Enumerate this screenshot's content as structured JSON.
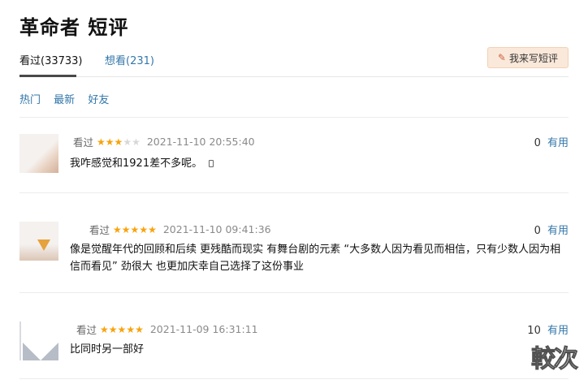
{
  "page": {
    "title": "革命者 短评"
  },
  "tabs": [
    {
      "label": "看过(33733)",
      "active": true
    },
    {
      "label": "想看(231)",
      "active": false
    }
  ],
  "write_button": {
    "label": "我来写短评",
    "icon": "pencil-icon"
  },
  "sort_options": [
    "热门",
    "最新",
    "好友"
  ],
  "comments": [
    {
      "username": "",
      "status": "看过",
      "rating": 3,
      "max_rating": 5,
      "time": "2021-11-10 20:55:40",
      "useful_count": "0",
      "useful_label": "有用",
      "text": "我咋感觉和1921差不多呢。",
      "from_mobile": true
    },
    {
      "username": "",
      "status": "看过",
      "rating": 5,
      "max_rating": 5,
      "time": "2021-11-10 09:41:36",
      "useful_count": "0",
      "useful_label": "有用",
      "text": "像是觉醒年代的回顾和后续 更残酷而现实 有舞台剧的元素 “大多数人因为看见而相信，只有少数人因为相信而看见” 劲很大 也更加庆幸自己选择了这份事业",
      "from_mobile": false
    },
    {
      "username": "",
      "status": "看过",
      "rating": 5,
      "max_rating": 5,
      "time": "2021-11-09 16:31:11",
      "useful_count": "10",
      "useful_label": "有用",
      "text": "比同时另一部好",
      "from_mobile": false
    }
  ],
  "watermark": "較次",
  "colors": {
    "link": "#3377aa",
    "star": "#f7a30c",
    "button_bg": "#fae9da"
  }
}
